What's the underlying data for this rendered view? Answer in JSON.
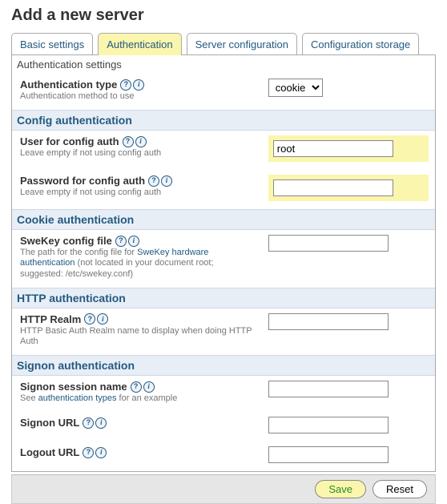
{
  "title": "Add a new server",
  "tabs": [
    "Basic settings",
    "Authentication",
    "Server configuration",
    "Configuration storage"
  ],
  "panel_title": "Authentication settings",
  "groups": {
    "auth_type": {
      "label": "Authentication type",
      "hint": "Authentication method to use",
      "value": "cookie"
    },
    "config_head": "Config authentication",
    "config_user": {
      "label": "User for config auth",
      "hint": "Leave empty if not using config auth",
      "value": "root"
    },
    "config_pass": {
      "label": "Password for config auth",
      "hint": "Leave empty if not using config auth",
      "value": ""
    },
    "cookie_head": "Cookie authentication",
    "swekey": {
      "label": "SweKey config file",
      "hint_pre": "The path for the config file for ",
      "hint_link": "SweKey hardware authentication",
      "hint_post": " (not located in your document root; suggested: /etc/swekey.conf)",
      "value": ""
    },
    "http_head": "HTTP authentication",
    "http_realm": {
      "label": "HTTP Realm",
      "hint": "HTTP Basic Auth Realm name to display when doing HTTP Auth",
      "value": ""
    },
    "signon_head": "Signon authentication",
    "signon_name": {
      "label": "Signon session name",
      "hint_pre": "See ",
      "hint_link": "authentication types",
      "hint_post": " for an example",
      "value": ""
    },
    "signon_url": {
      "label": "Signon URL",
      "value": ""
    },
    "logout_url": {
      "label": "Logout URL",
      "value": ""
    }
  },
  "buttons": {
    "save": "Save",
    "reset": "Reset"
  }
}
